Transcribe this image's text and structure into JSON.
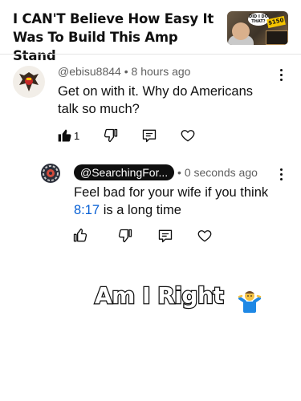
{
  "video": {
    "title": "I CAN'T Believe How Easy It Was To Build This Amp Stand",
    "thumbnail_bubble": "DID I DO THAT?",
    "thumbnail_badge": "$150"
  },
  "comment": {
    "author": "@ebisu8844",
    "time": "8 hours ago",
    "separator": "•",
    "text": "Get on with it. Why do Americans talk so much?",
    "likes": "1",
    "icons": {
      "like": "thumbs-up-filled-icon",
      "dislike": "thumbs-down-icon",
      "reply": "reply-icon",
      "heart": "heart-icon",
      "more": "more-vertical-icon"
    }
  },
  "reply": {
    "author": "@SearchingFor...",
    "time": "0 seconds ago",
    "separator": "•",
    "text_before": "Feel bad for your wife if you think ",
    "timestamp": "8:17",
    "text_after": " is a long time"
  },
  "overlay": {
    "caption": "Am I Right",
    "emoji": "person-shrugging"
  },
  "colors": {
    "link": "#065fd4",
    "meta": "#606060",
    "text": "#0f0f0f",
    "pill": "#0f0f0f"
  }
}
